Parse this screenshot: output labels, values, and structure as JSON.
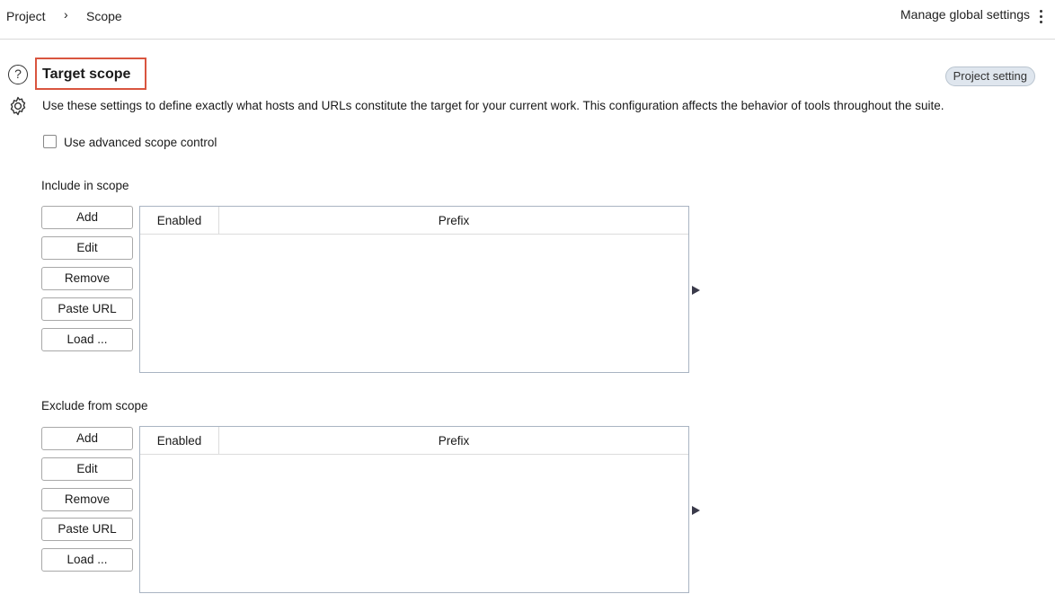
{
  "breadcrumb": {
    "project": "Project",
    "separator": "›",
    "scope": "Scope"
  },
  "header": {
    "manage_label": "Manage global settings",
    "menu_icon": "kebab-icon"
  },
  "section": {
    "title": "Target scope",
    "badge": "Project setting",
    "description": "Use these settings to define exactly what hosts and URLs constitute the target for your current work. This configuration affects the behavior of tools throughout the suite.",
    "advanced_checkbox_label": "Use advanced scope control",
    "advanced_checked": false,
    "help_icon": "help-icon",
    "settings_icon": "gear-icon",
    "highlight_color": "#d9553f"
  },
  "include": {
    "label": "Include in scope",
    "buttons": {
      "add": "Add",
      "edit": "Edit",
      "remove": "Remove",
      "paste": "Paste URL",
      "load": "Load ..."
    },
    "columns": {
      "enabled": "Enabled",
      "prefix": "Prefix"
    },
    "rows": []
  },
  "exclude": {
    "label": "Exclude from scope",
    "buttons": {
      "add": "Add",
      "edit": "Edit",
      "remove": "Remove",
      "paste": "Paste URL",
      "load": "Load ..."
    },
    "columns": {
      "enabled": "Enabled",
      "prefix": "Prefix"
    },
    "rows": []
  }
}
